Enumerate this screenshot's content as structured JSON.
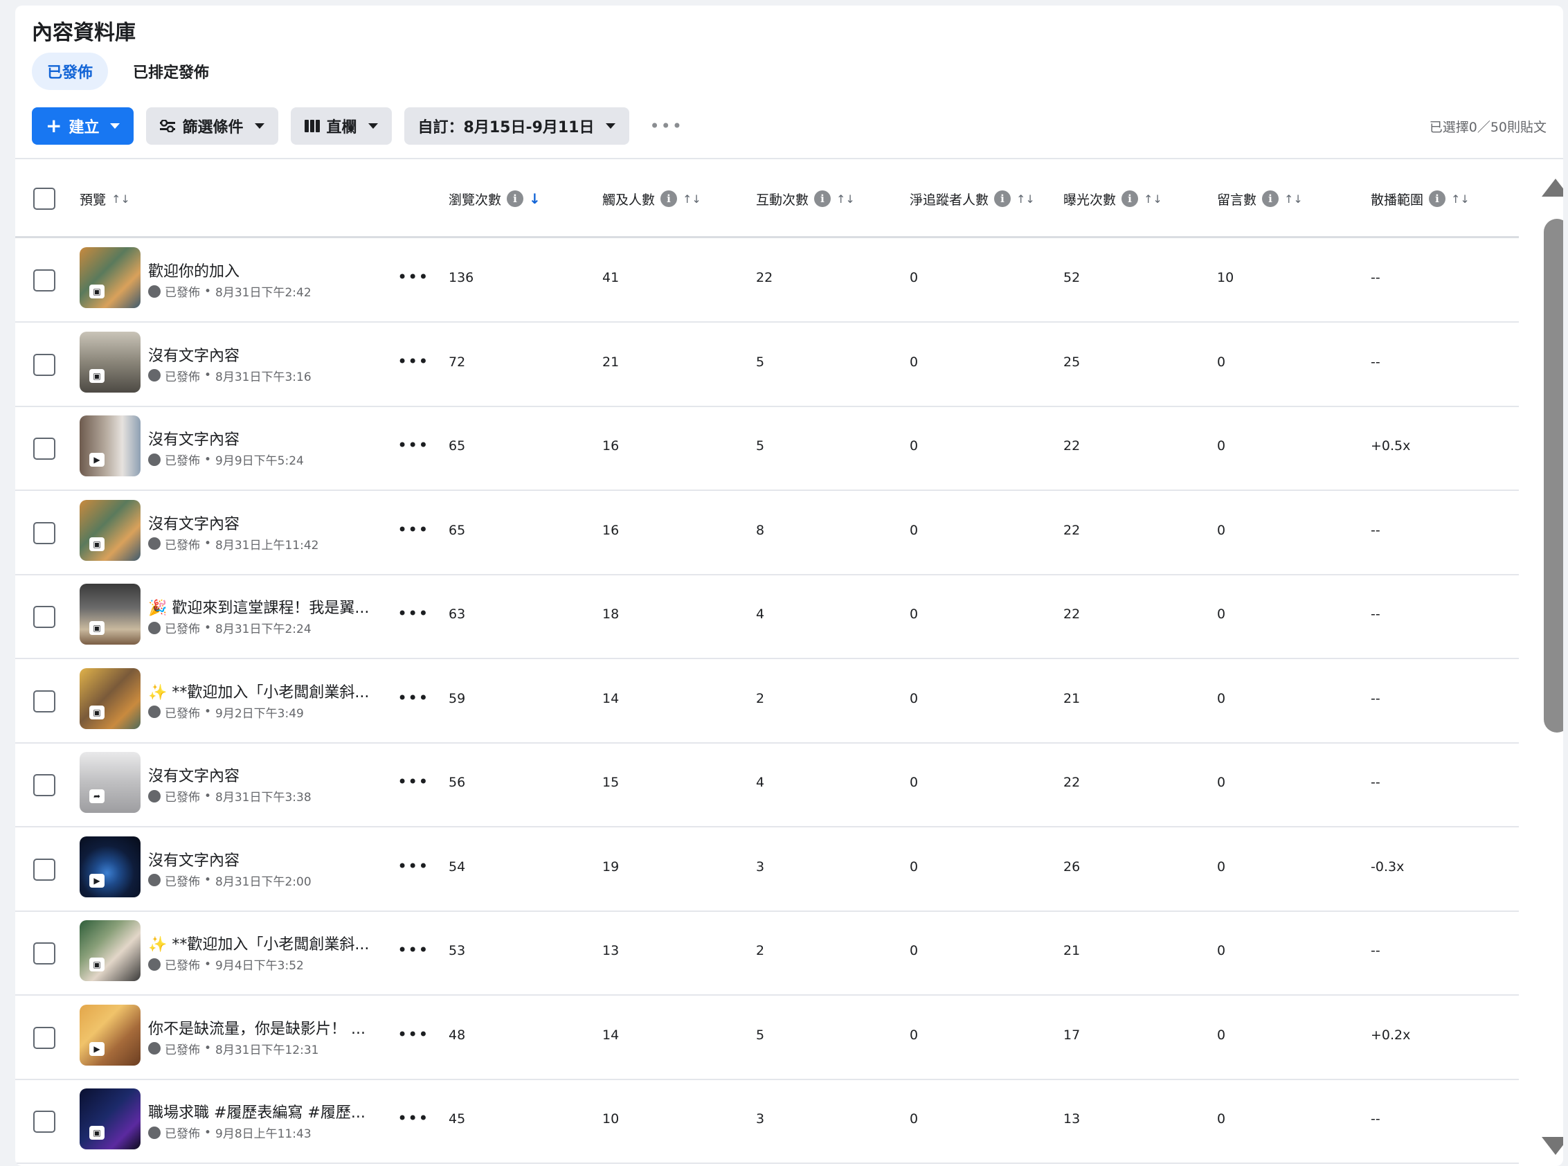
{
  "page": {
    "title": "內容資料庫"
  },
  "tabs": [
    {
      "label": "已發佈",
      "active": true
    },
    {
      "label": "已排定發佈",
      "active": false
    }
  ],
  "toolbar": {
    "create_label": "建立",
    "filter_label": "篩選條件",
    "columns_label": "直欄",
    "date_label": "自訂：8月15日-9月11日",
    "more_label": "•••",
    "selected_count": "已選擇0／50則貼文"
  },
  "columns": {
    "preview": "預覽",
    "views": "瀏覽次數",
    "reach": "觸及人數",
    "interactions": "互動次數",
    "net_follows": "淨追蹤者人數",
    "impressions": "曝光次數",
    "comments": "留言數",
    "distribution": "散播範圍"
  },
  "icons": {
    "info": "i",
    "sort": "↑↓",
    "sort_active": "↓",
    "more": "•••"
  },
  "rows": [
    {
      "title": "歡迎你的加入",
      "status": "已發佈",
      "date": "8月31日下午2:42",
      "type": "photo",
      "thumb": "crowd",
      "views": "136",
      "reach": "41",
      "interactions": "22",
      "net_follows": "0",
      "impressions": "52",
      "comments": "10",
      "distribution": "--"
    },
    {
      "title": "沒有文字內容",
      "status": "已發佈",
      "date": "8月31日下午3:16",
      "type": "photo",
      "thumb": "classroom",
      "views": "72",
      "reach": "21",
      "interactions": "5",
      "net_follows": "0",
      "impressions": "25",
      "comments": "0",
      "distribution": "--"
    },
    {
      "title": "沒有文字內容",
      "status": "已發佈",
      "date": "9月9日下午5:24",
      "type": "video",
      "thumb": "avatar",
      "views": "65",
      "reach": "16",
      "interactions": "5",
      "net_follows": "0",
      "impressions": "22",
      "comments": "0",
      "distribution": "+0.5x"
    },
    {
      "title": "沒有文字內容",
      "status": "已發佈",
      "date": "8月31日上午11:42",
      "type": "photo",
      "thumb": "crowd",
      "views": "65",
      "reach": "16",
      "interactions": "8",
      "net_follows": "0",
      "impressions": "22",
      "comments": "0",
      "distribution": "--"
    },
    {
      "title": "🎉 歡迎來到這堂課程！我是翼...",
      "status": "已發佈",
      "date": "8月31日下午2:24",
      "type": "photo",
      "thumb": "figure",
      "views": "63",
      "reach": "18",
      "interactions": "4",
      "net_follows": "0",
      "impressions": "22",
      "comments": "0",
      "distribution": "--"
    },
    {
      "title": "✨ **歡迎加入「小老闆創業斜...",
      "status": "已發佈",
      "date": "9月2日下午3:49",
      "type": "photo",
      "thumb": "crowd2",
      "views": "59",
      "reach": "14",
      "interactions": "2",
      "net_follows": "0",
      "impressions": "21",
      "comments": "0",
      "distribution": "--"
    },
    {
      "title": "沒有文字內容",
      "status": "已發佈",
      "date": "8月31日下午3:38",
      "type": "share",
      "thumb": "share",
      "views": "56",
      "reach": "15",
      "interactions": "4",
      "net_follows": "0",
      "impressions": "22",
      "comments": "0",
      "distribution": "--"
    },
    {
      "title": "沒有文字內容",
      "status": "已發佈",
      "date": "8月31日下午2:00",
      "type": "video",
      "thumb": "earth",
      "views": "54",
      "reach": "19",
      "interactions": "3",
      "net_follows": "0",
      "impressions": "26",
      "comments": "0",
      "distribution": "-0.3x"
    },
    {
      "title": "✨ **歡迎加入「小老闆創業斜...",
      "status": "已發佈",
      "date": "9月4日下午3:52",
      "type": "photo",
      "thumb": "woman",
      "views": "53",
      "reach": "13",
      "interactions": "2",
      "net_follows": "0",
      "impressions": "21",
      "comments": "0",
      "distribution": "--"
    },
    {
      "title": "你不是缺流量，你是缺影片！ ...",
      "status": "已發佈",
      "date": "8月31日下午12:31",
      "type": "video",
      "thumb": "cartoon",
      "views": "48",
      "reach": "14",
      "interactions": "5",
      "net_follows": "0",
      "impressions": "17",
      "comments": "0",
      "distribution": "+0.2x"
    },
    {
      "title": "職場求職 #履歷表編寫 #履歷...",
      "status": "已發佈",
      "date": "9月8日上午11:43",
      "type": "photo",
      "thumb": "dark",
      "views": "45",
      "reach": "10",
      "interactions": "3",
      "net_follows": "0",
      "impressions": "13",
      "comments": "0",
      "distribution": "--"
    }
  ],
  "colors": {
    "accent": "#1877f2",
    "tab_active_bg": "#e7f0fd",
    "tab_active_text": "#1264d6"
  }
}
